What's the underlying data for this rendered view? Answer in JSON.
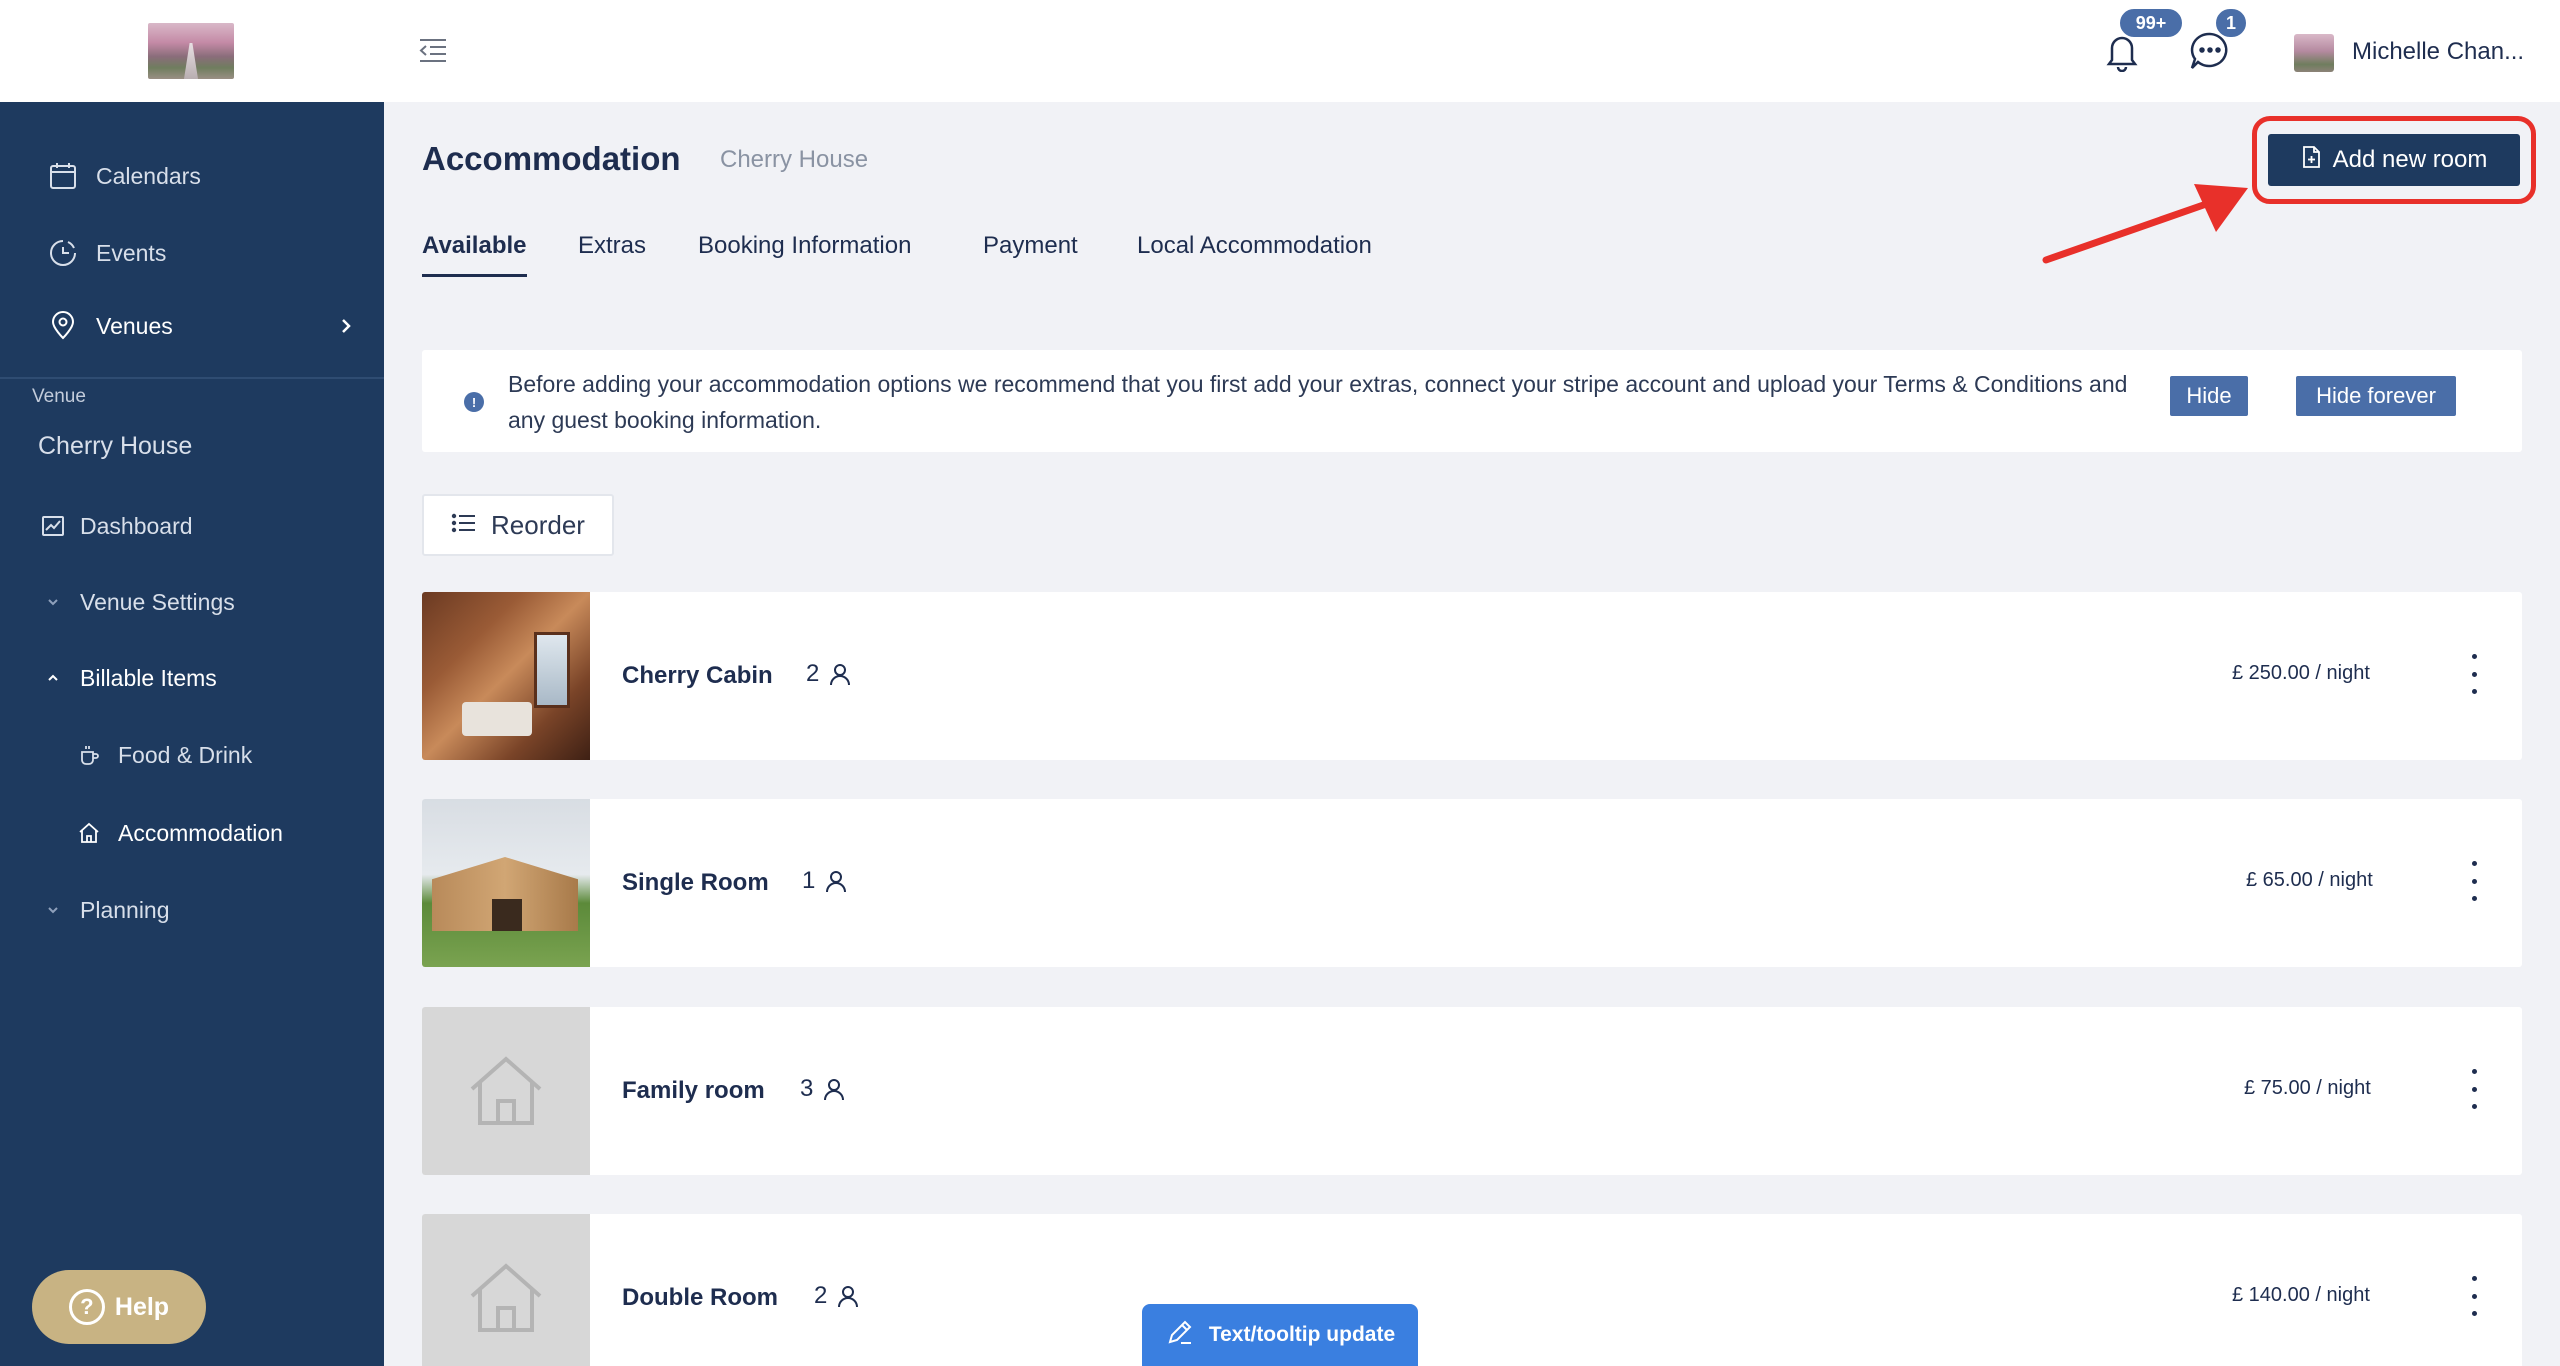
{
  "sidebar": {
    "nav": [
      {
        "label": "Calendars",
        "icon": "calendar-icon"
      },
      {
        "label": "Events",
        "icon": "events-icon"
      },
      {
        "label": "Venues",
        "icon": "location-pin-icon"
      }
    ],
    "venue_label": "Venue",
    "venue_name": "Cherry House",
    "venue_nav": [
      {
        "label": "Dashboard",
        "icon": "chart-icon"
      },
      {
        "label": "Venue Settings",
        "icon": "chevron-down-icon"
      },
      {
        "label": "Billable Items",
        "icon": "chevron-up-icon"
      },
      {
        "label": "Food & Drink",
        "icon": "cup-icon"
      },
      {
        "label": "Accommodation",
        "icon": "home-icon"
      },
      {
        "label": "Planning",
        "icon": "chevron-down-icon"
      }
    ],
    "help_label": "Help"
  },
  "topbar": {
    "notification_count": "99+",
    "message_count": "1",
    "user_name": "Michelle Chan..."
  },
  "page": {
    "title": "Accommodation",
    "subtitle": "Cherry House",
    "add_button": "Add new room"
  },
  "tabs": [
    {
      "label": "Available",
      "active": true
    },
    {
      "label": "Extras",
      "active": false
    },
    {
      "label": "Booking Information",
      "active": false
    },
    {
      "label": "Payment",
      "active": false
    },
    {
      "label": "Local Accommodation",
      "active": false
    }
  ],
  "banner": {
    "text": "Before adding your accommodation options we recommend that you first add your extras, connect your stripe account and upload your Terms & Conditions and any guest booking information.",
    "hide_label": "Hide",
    "hide_forever_label": "Hide forever"
  },
  "reorder_label": "Reorder",
  "rooms": [
    {
      "name": "Cherry Cabin",
      "capacity": "2",
      "price": "£ 250.00 / night",
      "image": "cabin-photo"
    },
    {
      "name": "Single Room",
      "capacity": "1",
      "price": "£ 65.00 / night",
      "image": "barn-photo"
    },
    {
      "name": "Family room",
      "capacity": "3",
      "price": "£ 75.00 / night",
      "image": "placeholder-home-icon"
    },
    {
      "name": "Double Room",
      "capacity": "2",
      "price": "£ 140.00 / night",
      "image": "placeholder-home-icon"
    }
  ],
  "feedback_label": "Text/tooltip update",
  "colors": {
    "sidebar": "#1e3a5f",
    "primary": "#1e3a5f",
    "accent": "#4a6ea8",
    "help": "#c8b383",
    "highlight": "#e8302a",
    "feedback": "#3a7fe0"
  }
}
